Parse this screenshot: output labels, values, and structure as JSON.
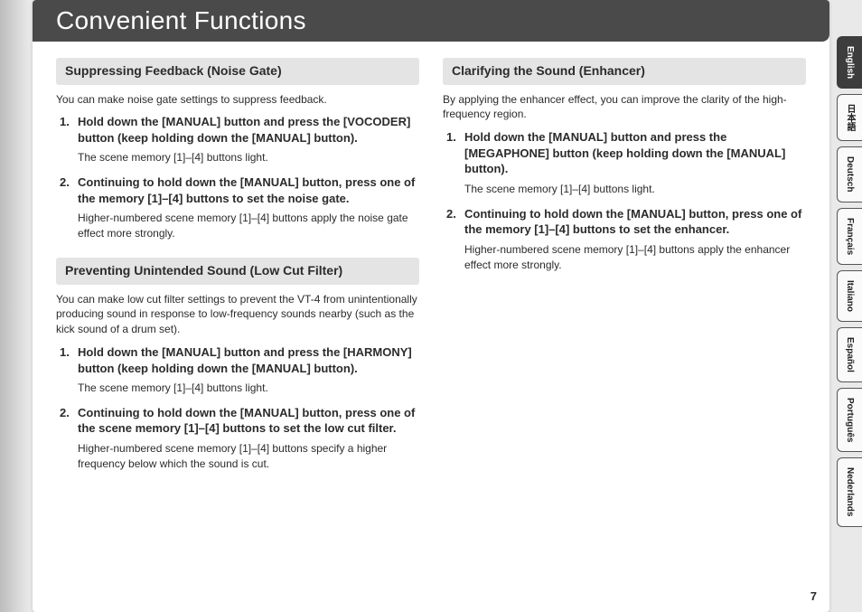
{
  "title": "Convenient Functions",
  "page_number": "7",
  "languages": [
    {
      "label": "English",
      "active": true
    },
    {
      "label": "日本語",
      "active": false
    },
    {
      "label": "Deutsch",
      "active": false
    },
    {
      "label": "Français",
      "active": false
    },
    {
      "label": "Italiano",
      "active": false
    },
    {
      "label": "Español",
      "active": false
    },
    {
      "label": "Português",
      "active": false
    },
    {
      "label": "Nederlands",
      "active": false
    }
  ],
  "left": {
    "section1": {
      "heading": "Suppressing Feedback (Noise Gate)",
      "intro": "You can make noise gate settings to suppress feedback.",
      "step1_title": "Hold down the [MANUAL] button and press the [VOCODER] button (keep holding down the [MANUAL] button).",
      "step1_detail": "The scene memory [1]–[4] buttons light.",
      "step2_title": "Continuing to hold down the [MANUAL] button, press one of the memory [1]–[4] buttons to set the noise gate.",
      "step2_detail": "Higher-numbered scene memory [1]–[4] buttons apply the noise gate effect more strongly."
    },
    "section2": {
      "heading": "Preventing Unintended Sound (Low Cut Filter)",
      "intro": "You can make low cut filter settings to prevent the VT-4 from unintentionally producing sound in response to low-frequency sounds nearby (such as the kick sound of a drum set).",
      "step1_title": "Hold down the [MANUAL] button and press the [HARMONY] button (keep holding down the [MANUAL] button).",
      "step1_detail": "The scene memory [1]–[4] buttons light.",
      "step2_title": "Continuing to hold down the [MANUAL] button, press one of the scene memory [1]–[4] buttons to set the low cut filter.",
      "step2_detail": "Higher-numbered scene memory [1]–[4] buttons specify a higher frequency below which the sound is cut."
    }
  },
  "right": {
    "section1": {
      "heading": "Clarifying the Sound (Enhancer)",
      "intro": "By applying the enhancer effect, you can improve the clarity of the high-frequency region.",
      "step1_title": "Hold down the [MANUAL] button and press the [MEGAPHONE] button (keep holding down the [MANUAL] button).",
      "step1_detail": "The scene memory [1]–[4] buttons light.",
      "step2_title": "Continuing to hold down the [MANUAL] button, press one of the memory [1]–[4] buttons to set the enhancer.",
      "step2_detail": "Higher-numbered scene memory [1]–[4] buttons apply the enhancer effect more strongly."
    }
  }
}
